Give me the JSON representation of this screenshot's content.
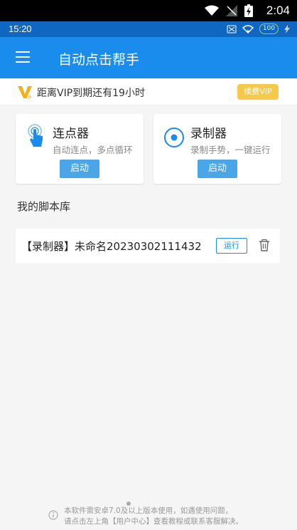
{
  "system": {
    "time": "2:04"
  },
  "status": {
    "time": "15:20",
    "battery": "100"
  },
  "app_bar": {
    "title": "自动点击帮手"
  },
  "vip": {
    "text": "距离VIP到期还有19小时",
    "button": "续费VIP"
  },
  "cards": [
    {
      "title": "连点器",
      "desc": "自动连点，多点循环",
      "button": "启动"
    },
    {
      "title": "录制器",
      "desc": "录制手势，一键运行",
      "button": "启动"
    }
  ],
  "scripts": {
    "section_title": "我的脚本库",
    "items": [
      {
        "name": "【录制器】未命名20230302111432",
        "run_label": "运行"
      }
    ]
  },
  "footer": {
    "line1": "本软件需安卓7.0及以上版本使用，如遇使用问题，",
    "line2": "请点击左上角【用户中心】查看教程或联系客服解决。"
  },
  "colors": {
    "primary": "#1a8cee",
    "button_blue": "#4aa6e6",
    "vip_yellow": "#f6c94a"
  }
}
